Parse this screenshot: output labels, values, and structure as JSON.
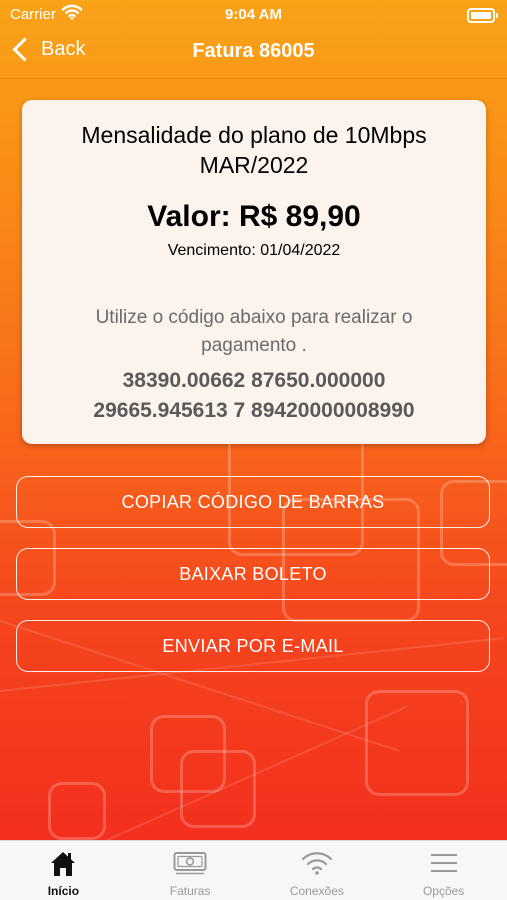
{
  "status_bar": {
    "carrier": "Carrier",
    "time": "9:04 AM"
  },
  "nav": {
    "back_label": "Back",
    "title": "Fatura 86005"
  },
  "invoice": {
    "plan_line1": "Mensalidade do plano de 10Mbps",
    "plan_line2": "MAR/2022",
    "valor": "Valor: R$ 89,90",
    "vencimento": "Vencimento: 01/04/2022",
    "instruction": "Utilize o código abaixo para realizar o pagamento .",
    "barcode_line1": "38390.00662 87650.000000",
    "barcode_line2": "29665.945613 7 89420000008990"
  },
  "actions": {
    "copy_label": "COPIAR CÓDIGO DE BARRAS",
    "download_label": "BAIXAR BOLETO",
    "email_label": "ENVIAR POR E-MAIL"
  },
  "tabs": [
    {
      "label": "Início",
      "icon": "home-icon",
      "active": true
    },
    {
      "label": "Faturas",
      "icon": "banknote-icon",
      "active": false
    },
    {
      "label": "Conexões",
      "icon": "wifi-icon",
      "active": false
    },
    {
      "label": "Opções",
      "icon": "menu-icon",
      "active": false
    }
  ],
  "colors": {
    "gradient_top": "#f9a318",
    "gradient_bottom": "#f22a1e",
    "card_background": "#fbf3ec",
    "tab_active": "#111111",
    "tab_inactive": "#9a9a9a"
  }
}
